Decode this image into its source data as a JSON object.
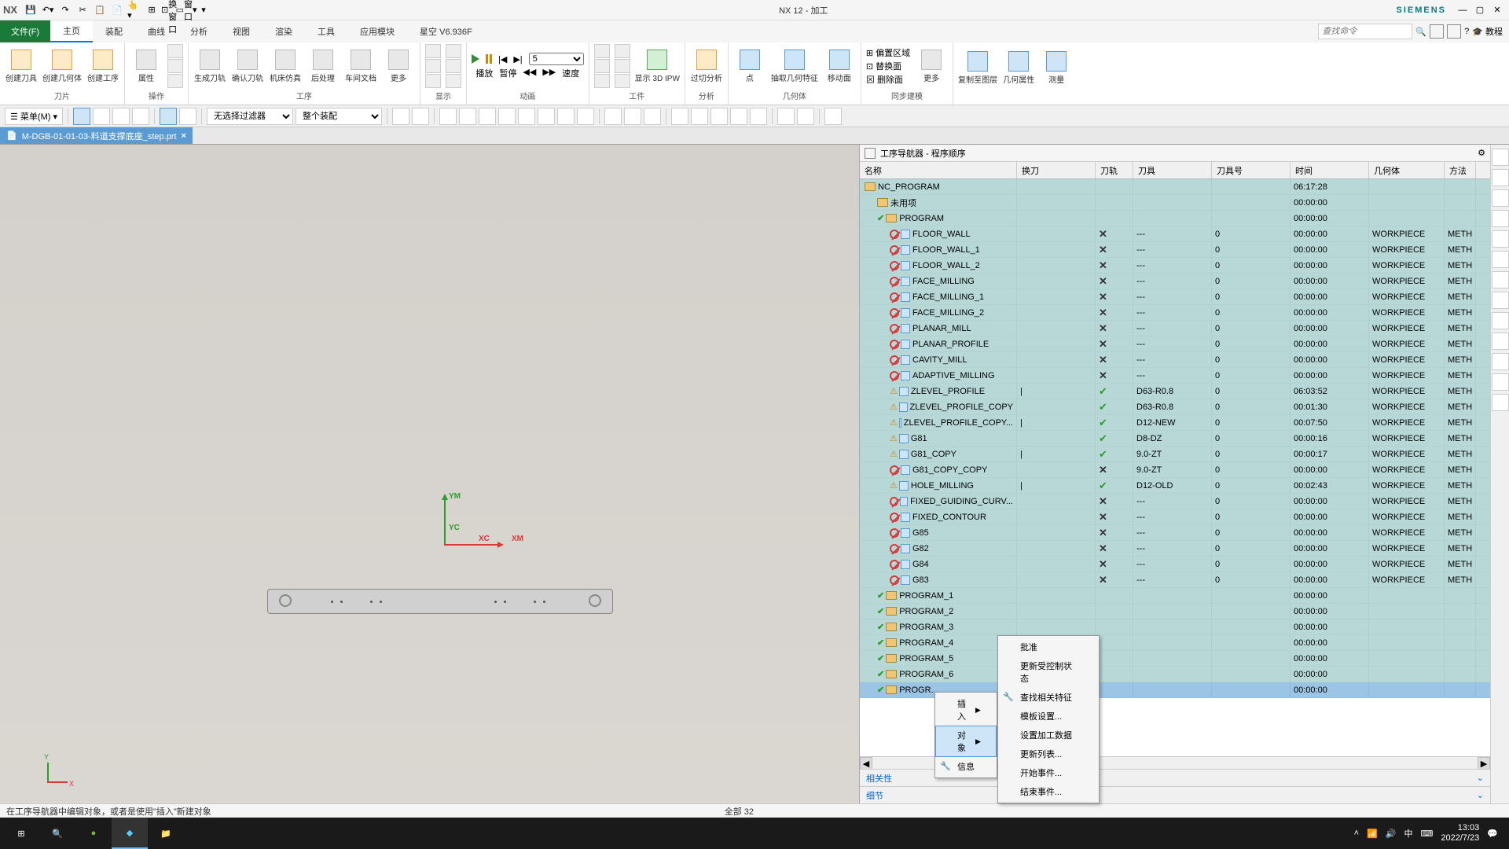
{
  "titlebar": {
    "logo": "NX",
    "qat_toggle": "切换窗口",
    "qat_window": "窗口",
    "title": "NX 12 - 加工",
    "brand": "SIEMENS"
  },
  "menu": {
    "file": "文件(F)",
    "tabs": [
      "主页",
      "装配",
      "曲线",
      "分析",
      "视图",
      "渲染",
      "工具",
      "应用模块",
      "星空 V6.936F"
    ],
    "search_ph": "查找命令",
    "tutorial": "教程"
  },
  "ribbon": {
    "groups": {
      "blade": {
        "label": "刀片",
        "btns": [
          "创建刀具",
          "创建几何体",
          "创建工序"
        ]
      },
      "operate": {
        "label": "操作",
        "btns": [
          "属性"
        ]
      },
      "process": {
        "label": "工序",
        "btns": [
          "生成刀轨",
          "确认刀轨",
          "机床仿真",
          "后处理",
          "车间文档",
          "更多"
        ]
      },
      "display": {
        "label": "显示"
      },
      "anim": {
        "label": "动画",
        "play": "播放",
        "pause": "暂停",
        "speed": "速度",
        "speed_val": "5"
      },
      "workpiece": {
        "label": "工件",
        "ipw": "显示 3D IPW"
      },
      "analyze": {
        "label": "分析",
        "btn": "过切分析"
      },
      "geo": {
        "label": "几何体",
        "btns": [
          "点",
          "抽取几何特征",
          "移动面"
        ]
      },
      "sync": {
        "label": "同步建模",
        "btns": [
          "偏置区域",
          "替换面",
          "删除面"
        ],
        "more": "更多"
      },
      "geo2": {
        "btns": [
          "复制至图层",
          "几何属性",
          "测量"
        ]
      }
    }
  },
  "toolbar": {
    "menu_btn": "菜单(M)",
    "filter1": "无选择过滤器",
    "filter2": "整个装配"
  },
  "doctab": {
    "name": "M-DGB-01-01-03-料道支撑底座_step.prt"
  },
  "viewport": {
    "axes": {
      "ym": "YM",
      "yc": "YC",
      "xc": "XC",
      "xm": "XM",
      "x": "X",
      "y": "Y"
    }
  },
  "nav": {
    "title": "工序导航器 - 程序顺序",
    "cols": [
      "名称",
      "换刀",
      "刀轨",
      "刀具",
      "刀具号",
      "时间",
      "几何体",
      "方法"
    ],
    "rows": [
      {
        "name": "NC_PROGRAM",
        "indent": 0,
        "type": "root",
        "time": "06:17:28"
      },
      {
        "name": "未用项",
        "indent": 1,
        "type": "folder",
        "time": "00:00:00"
      },
      {
        "name": "PROGRAM",
        "indent": 1,
        "type": "folder",
        "status": "green",
        "time": "00:00:00"
      },
      {
        "name": "FLOOR_WALL",
        "indent": 2,
        "type": "op",
        "status": "red",
        "track": "x",
        "tool": "---",
        "tn": "0",
        "time": "00:00:00",
        "geo": "WORKPIECE",
        "meth": "METH"
      },
      {
        "name": "FLOOR_WALL_1",
        "indent": 2,
        "type": "op",
        "status": "red",
        "track": "x",
        "tool": "---",
        "tn": "0",
        "time": "00:00:00",
        "geo": "WORKPIECE",
        "meth": "METH"
      },
      {
        "name": "FLOOR_WALL_2",
        "indent": 2,
        "type": "op",
        "status": "red",
        "track": "x",
        "tool": "---",
        "tn": "0",
        "time": "00:00:00",
        "geo": "WORKPIECE",
        "meth": "METH"
      },
      {
        "name": "FACE_MILLING",
        "indent": 2,
        "type": "op",
        "status": "red",
        "track": "x",
        "tool": "---",
        "tn": "0",
        "time": "00:00:00",
        "geo": "WORKPIECE",
        "meth": "METH"
      },
      {
        "name": "FACE_MILLING_1",
        "indent": 2,
        "type": "op",
        "status": "red",
        "track": "x",
        "tool": "---",
        "tn": "0",
        "time": "00:00:00",
        "geo": "WORKPIECE",
        "meth": "METH"
      },
      {
        "name": "FACE_MILLING_2",
        "indent": 2,
        "type": "op",
        "status": "red",
        "track": "x",
        "tool": "---",
        "tn": "0",
        "time": "00:00:00",
        "geo": "WORKPIECE",
        "meth": "METH"
      },
      {
        "name": "PLANAR_MILL",
        "indent": 2,
        "type": "op",
        "status": "red",
        "track": "x",
        "tool": "---",
        "tn": "0",
        "time": "00:00:00",
        "geo": "WORKPIECE",
        "meth": "METH"
      },
      {
        "name": "PLANAR_PROFILE",
        "indent": 2,
        "type": "op",
        "status": "red",
        "track": "x",
        "tool": "---",
        "tn": "0",
        "time": "00:00:00",
        "geo": "WORKPIECE",
        "meth": "METH"
      },
      {
        "name": "CAVITY_MILL",
        "indent": 2,
        "type": "op",
        "status": "red",
        "track": "x",
        "tool": "---",
        "tn": "0",
        "time": "00:00:00",
        "geo": "WORKPIECE",
        "meth": "METH"
      },
      {
        "name": "ADAPTIVE_MILLING",
        "indent": 2,
        "type": "op",
        "status": "red",
        "track": "x",
        "tool": "---",
        "tn": "0",
        "time": "00:00:00",
        "geo": "WORKPIECE",
        "meth": "METH"
      },
      {
        "name": "ZLEVEL_PROFILE",
        "indent": 2,
        "type": "op",
        "status": "warn",
        "swap": "|",
        "track": "v",
        "tool": "D63-R0.8",
        "tn": "0",
        "time": "06:03:52",
        "geo": "WORKPIECE",
        "meth": "METH"
      },
      {
        "name": "ZLEVEL_PROFILE_COPY",
        "indent": 2,
        "type": "op",
        "status": "warn",
        "track": "v",
        "tool": "D63-R0.8",
        "tn": "0",
        "time": "00:01:30",
        "geo": "WORKPIECE",
        "meth": "METH"
      },
      {
        "name": "ZLEVEL_PROFILE_COPY...",
        "indent": 2,
        "type": "op",
        "status": "warn",
        "swap": "|",
        "track": "v",
        "tool": "D12-NEW",
        "tn": "0",
        "time": "00:07:50",
        "geo": "WORKPIECE",
        "meth": "METH"
      },
      {
        "name": "G81",
        "indent": 2,
        "type": "op",
        "status": "warn",
        "track": "v",
        "tool": "D8-DZ",
        "tn": "0",
        "time": "00:00:16",
        "geo": "WORKPIECE",
        "meth": "METH"
      },
      {
        "name": "G81_COPY",
        "indent": 2,
        "type": "op",
        "status": "warn",
        "swap": "|",
        "track": "v",
        "tool": "9.0-ZT",
        "tn": "0",
        "time": "00:00:17",
        "geo": "WORKPIECE",
        "meth": "METH"
      },
      {
        "name": "G81_COPY_COPY",
        "indent": 2,
        "type": "op",
        "status": "red",
        "track": "x",
        "tool": "9.0-ZT",
        "tn": "0",
        "time": "00:00:00",
        "geo": "WORKPIECE",
        "meth": "METH"
      },
      {
        "name": "HOLE_MILLING",
        "indent": 2,
        "type": "op",
        "status": "warn",
        "swap": "|",
        "track": "v",
        "tool": "D12-OLD",
        "tn": "0",
        "time": "00:02:43",
        "geo": "WORKPIECE",
        "meth": "METH"
      },
      {
        "name": "FIXED_GUIDING_CURV...",
        "indent": 2,
        "type": "op",
        "status": "red",
        "track": "x",
        "tool": "---",
        "tn": "0",
        "time": "00:00:00",
        "geo": "WORKPIECE",
        "meth": "METH"
      },
      {
        "name": "FIXED_CONTOUR",
        "indent": 2,
        "type": "op",
        "status": "red",
        "track": "x",
        "tool": "---",
        "tn": "0",
        "time": "00:00:00",
        "geo": "WORKPIECE",
        "meth": "METH"
      },
      {
        "name": "G85",
        "indent": 2,
        "type": "op",
        "status": "red",
        "track": "x",
        "tool": "---",
        "tn": "0",
        "time": "00:00:00",
        "geo": "WORKPIECE",
        "meth": "METH"
      },
      {
        "name": "G82",
        "indent": 2,
        "type": "op",
        "status": "red",
        "track": "x",
        "tool": "---",
        "tn": "0",
        "time": "00:00:00",
        "geo": "WORKPIECE",
        "meth": "METH"
      },
      {
        "name": "G84",
        "indent": 2,
        "type": "op",
        "status": "red",
        "track": "x",
        "tool": "---",
        "tn": "0",
        "time": "00:00:00",
        "geo": "WORKPIECE",
        "meth": "METH"
      },
      {
        "name": "G83",
        "indent": 2,
        "type": "op",
        "status": "red",
        "track": "x",
        "tool": "---",
        "tn": "0",
        "time": "00:00:00",
        "geo": "WORKPIECE",
        "meth": "METH"
      },
      {
        "name": "PROGRAM_1",
        "indent": 1,
        "type": "folder",
        "status": "green",
        "time": "00:00:00"
      },
      {
        "name": "PROGRAM_2",
        "indent": 1,
        "type": "folder",
        "status": "green",
        "time": "00:00:00"
      },
      {
        "name": "PROGRAM_3",
        "indent": 1,
        "type": "folder",
        "status": "green",
        "time": "00:00:00"
      },
      {
        "name": "PROGRAM_4",
        "indent": 1,
        "type": "folder",
        "status": "green",
        "time": "00:00:00"
      },
      {
        "name": "PROGRAM_5",
        "indent": 1,
        "type": "folder",
        "status": "green",
        "time": "00:00:00"
      },
      {
        "name": "PROGRAM_6",
        "indent": 1,
        "type": "folder",
        "status": "green",
        "time": "00:00:00"
      },
      {
        "name": "PROGR...",
        "indent": 1,
        "type": "folder",
        "status": "green",
        "time": "00:00:00",
        "sel": true
      }
    ],
    "footer1": "相关性",
    "footer2": "细节"
  },
  "ctx1": {
    "items": [
      {
        "label": "插入",
        "arrow": true
      },
      {
        "label": "对象",
        "arrow": true,
        "hl": true
      },
      {
        "label": "信息",
        "icon": true
      }
    ]
  },
  "ctx2": {
    "items": [
      {
        "label": "批准"
      },
      {
        "label": "更新受控制状态"
      },
      {
        "label": "查找相关特征",
        "icon": true
      },
      {
        "label": "模板设置..."
      },
      {
        "label": "设置加工数据"
      },
      {
        "label": "更新列表..."
      },
      {
        "label": "开始事件..."
      },
      {
        "label": "结束事件..."
      }
    ]
  },
  "statusbar": {
    "left": "在工序导航器中编辑对象，或者是使用\"插入\"新建对象",
    "center": "全部 32"
  },
  "taskbar": {
    "time": "13:03",
    "date": "2022/7/23",
    "ime": "中"
  },
  "col_widths": {
    "name": 200,
    "swap": 100,
    "track": 48,
    "tool": 100,
    "tn": 100,
    "time": 100,
    "geo": 96,
    "meth": 40
  }
}
